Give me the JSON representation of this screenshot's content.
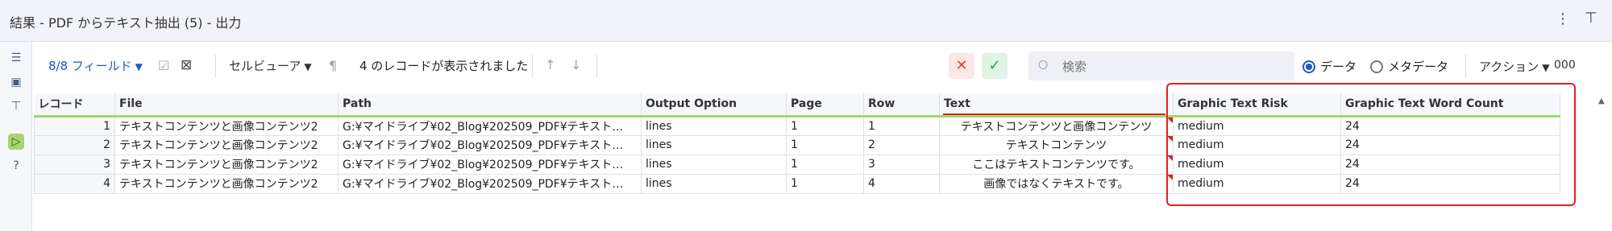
{
  "window": {
    "title": "結果 - PDF からテキスト抽出 (5) - 出力"
  },
  "toolbar": {
    "fields_label": "8/8 フィールド",
    "cell_view_label": "セルビューア",
    "record_count_text": "4 のレコードが表示されました",
    "search_placeholder": "検索",
    "radio_data_label": "データ",
    "radio_metadata_label": "メタデータ",
    "radio_selected": "データ",
    "action_label": "アクション",
    "zeros_label": "000"
  },
  "colors": {
    "accent": "#2257c9",
    "header_underline": "#9fd86b",
    "highlight_red": "#e02020"
  },
  "table": {
    "columns": [
      "レコード",
      "File",
      "Path",
      "Output Option",
      "Page",
      "Row",
      "Text",
      "Graphic Text Risk",
      "Graphic Text Word Count"
    ],
    "rows": [
      {
        "record": "1",
        "file": "テキストコンテンツと画像コンテンツ2",
        "path": "G:¥マイドライブ¥02_Blog¥202509_PDF¥テキスト…",
        "output_option": "lines",
        "page": "1",
        "row": "1",
        "text": "テキストコンテンツと画像コンテンツ",
        "risk": "medium",
        "word_count": "24"
      },
      {
        "record": "2",
        "file": "テキストコンテンツと画像コンテンツ2",
        "path": "G:¥マイドライブ¥02_Blog¥202509_PDF¥テキスト…",
        "output_option": "lines",
        "page": "1",
        "row": "2",
        "text": "テキストコンテンツ",
        "risk": "medium",
        "word_count": "24"
      },
      {
        "record": "3",
        "file": "テキストコンテンツと画像コンテンツ2",
        "path": "G:¥マイドライブ¥02_Blog¥202509_PDF¥テキスト…",
        "output_option": "lines",
        "page": "1",
        "row": "3",
        "text": "ここはテキストコンテンツです。",
        "risk": "medium",
        "word_count": "24"
      },
      {
        "record": "4",
        "file": "テキストコンテンツと画像コンテンツ2",
        "path": "G:¥マイドライブ¥02_Blog¥202509_PDF¥テキスト…",
        "output_option": "lines",
        "page": "1",
        "row": "4",
        "text": "画像ではなくテキストです。",
        "risk": "medium",
        "word_count": "24"
      }
    ]
  }
}
